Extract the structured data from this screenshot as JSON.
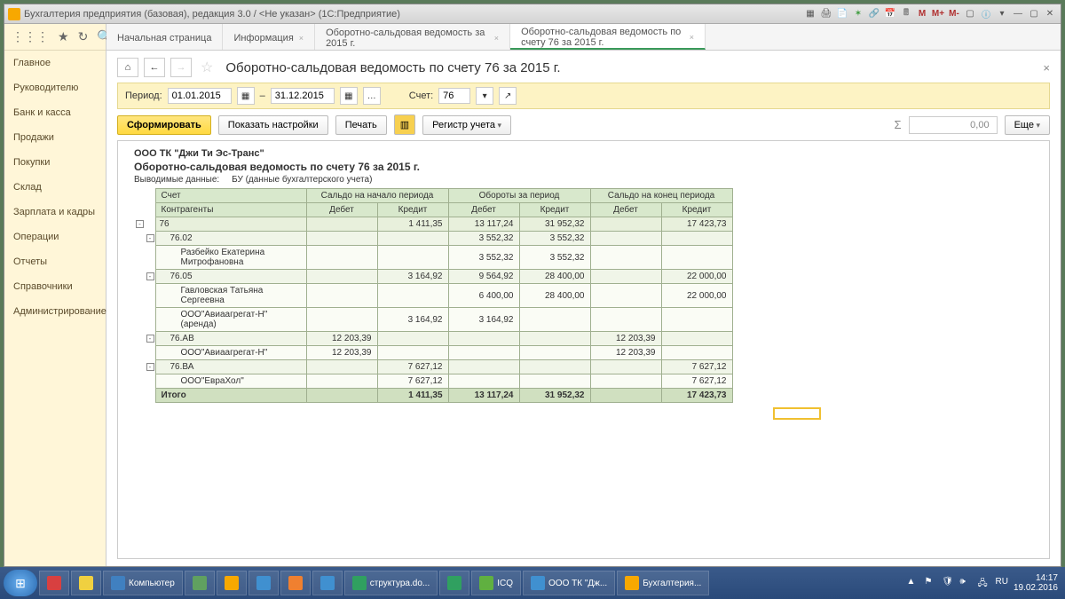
{
  "titlebar": {
    "text": "Бухгалтерия предприятия (базовая), редакция 3.0 / <Не указан>  (1С:Предприятие)",
    "m_btns": [
      "M",
      "M+",
      "M-"
    ]
  },
  "sidebar": {
    "items": [
      "Главное",
      "Руководителю",
      "Банк и касса",
      "Продажи",
      "Покупки",
      "Склад",
      "Зарплата и кадры",
      "Операции",
      "Отчеты",
      "Справочники",
      "Администрирование"
    ]
  },
  "tabs": [
    {
      "label": "Начальная страница",
      "closable": false
    },
    {
      "label": "Информация",
      "closable": true
    },
    {
      "label": "Оборотно-сальдовая ведомость за 2015 г.",
      "closable": true
    },
    {
      "label": "Оборотно-сальдовая ведомость по счету 76 за 2015 г.",
      "closable": true,
      "active": true
    }
  ],
  "page": {
    "title": "Оборотно-сальдовая ведомость по счету 76 за 2015 г."
  },
  "period": {
    "label": "Период:",
    "from": "01.01.2015",
    "dash": "–",
    "to": "31.12.2015",
    "acct_label": "Счет:",
    "acct": "76"
  },
  "actions": {
    "generate": "Сформировать",
    "settings": "Показать настройки",
    "print": "Печать",
    "register": "Регистр учета",
    "sigma": "Σ",
    "sum_value": "0,00",
    "more": "Еще"
  },
  "report": {
    "org": "ООО ТК \"Джи Ти Эс-Транс\"",
    "title": "Оборотно-сальдовая ведомость по счету 76 за 2015 г.",
    "out_label": "Выводимые данные:",
    "out_value": "БУ (данные бухгалтерского учета)",
    "hdr": {
      "acct": "Счет",
      "contr": "Контрагенты",
      "start": "Сальдо на начало периода",
      "turn": "Обороты за период",
      "end": "Сальдо на конец периода",
      "deb": "Дебет",
      "cred": "Кредит"
    },
    "rows": [
      {
        "lvl": 0,
        "exp": "-",
        "name": "76",
        "sd": "",
        "sc": "1 411,35",
        "td": "13 117,24",
        "tc": "31 952,32",
        "ed": "",
        "ec": "17 423,73"
      },
      {
        "lvl": 1,
        "exp": "-",
        "name": "76.02",
        "sd": "",
        "sc": "",
        "td": "3 552,32",
        "tc": "3 552,32",
        "ed": "",
        "ec": ""
      },
      {
        "lvl": 2,
        "exp": "",
        "name": "Разбейко Екатерина Митрофановна",
        "sd": "",
        "sc": "",
        "td": "3 552,32",
        "tc": "3 552,32",
        "ed": "",
        "ec": ""
      },
      {
        "lvl": 1,
        "exp": "-",
        "name": "76.05",
        "sd": "",
        "sc": "3 164,92",
        "td": "9 564,92",
        "tc": "28 400,00",
        "ed": "",
        "ec": "22 000,00"
      },
      {
        "lvl": 2,
        "exp": "",
        "name": "Гавловская Татьяна Сергеевна",
        "sd": "",
        "sc": "",
        "td": "6 400,00",
        "tc": "28 400,00",
        "ed": "",
        "ec": "22 000,00"
      },
      {
        "lvl": 2,
        "exp": "",
        "name": "ООО\"Авиаагрегат-Н\" (аренда)",
        "sd": "",
        "sc": "3 164,92",
        "td": "3 164,92",
        "tc": "",
        "ed": "",
        "ec": ""
      },
      {
        "lvl": 1,
        "exp": "-",
        "name": "76.АВ",
        "sd": "12 203,39",
        "sc": "",
        "td": "",
        "tc": "",
        "ed": "12 203,39",
        "ec": ""
      },
      {
        "lvl": 2,
        "exp": "",
        "name": "ООО\"Авиаагрегат-Н\"",
        "sd": "12 203,39",
        "sc": "",
        "td": "",
        "tc": "",
        "ed": "12 203,39",
        "ec": ""
      },
      {
        "lvl": 1,
        "exp": "-",
        "name": "76.ВА",
        "sd": "",
        "sc": "7 627,12",
        "td": "",
        "tc": "",
        "ed": "",
        "ec": "7 627,12"
      },
      {
        "lvl": 2,
        "exp": "",
        "name": "ООО\"ЕвраХол\"",
        "sd": "",
        "sc": "7 627,12",
        "td": "",
        "tc": "",
        "ed": "",
        "ec": "7 627,12"
      }
    ],
    "total": {
      "name": "Итого",
      "sd": "",
      "sc": "1 411,35",
      "td": "13 117,24",
      "tc": "31 952,32",
      "ed": "",
      "ec": "17 423,73"
    }
  },
  "taskbar": {
    "items": [
      {
        "label": "",
        "color": "#d84040"
      },
      {
        "label": "",
        "color": "#f0d040"
      },
      {
        "label": "Компьютер",
        "color": "#4080c0"
      },
      {
        "label": "",
        "color": "#60a060"
      },
      {
        "label": "",
        "color": "#f7a800"
      },
      {
        "label": "",
        "color": "#4090d0"
      },
      {
        "label": "",
        "color": "#f08030"
      },
      {
        "label": "",
        "color": "#4090d0"
      },
      {
        "label": "структура.do...",
        "color": "#30a060"
      },
      {
        "label": "",
        "color": "#30a060"
      },
      {
        "label": "ICQ",
        "color": "#60b040"
      },
      {
        "label": "ООО ТК \"Дж...",
        "color": "#4090d0"
      },
      {
        "label": "Бухгалтерия...",
        "color": "#f7a800"
      }
    ],
    "time": "14:17",
    "date": "19.02.2016"
  }
}
